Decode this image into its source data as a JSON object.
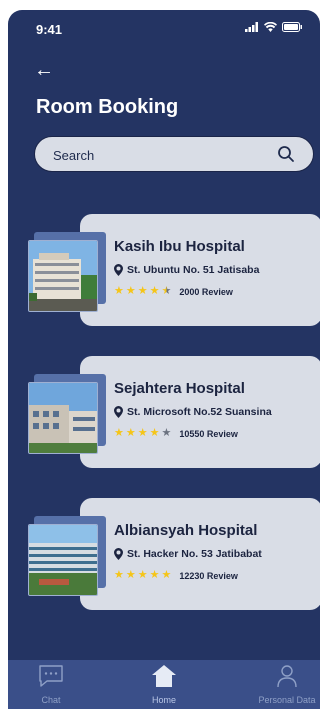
{
  "status": {
    "time": "9:41"
  },
  "header": {
    "back_symbol": "←",
    "title": "Room Booking"
  },
  "search": {
    "placeholder": "Search"
  },
  "hospitals": [
    {
      "name": "Kasih Ibu Hospital",
      "address": "St. Ubuntu No. 51 Jatisaba",
      "rating": 4.5,
      "reviews": "2000 Review"
    },
    {
      "name": "Sejahtera Hospital",
      "address": "St. Microsoft No.52 Suansina",
      "rating": 4,
      "reviews": "10550 Review"
    },
    {
      "name": "Albiansyah Hospital",
      "address": "St. Hacker No. 53 Jatibabat",
      "rating": 5,
      "reviews": "12230 Review"
    }
  ],
  "nav": {
    "chat": "Chat",
    "home": "Home",
    "personal": "Personal Data"
  },
  "colors": {
    "background": "#243463",
    "card": "#d9dde6",
    "star": "#f5c518",
    "nav": "#3a4f89"
  }
}
